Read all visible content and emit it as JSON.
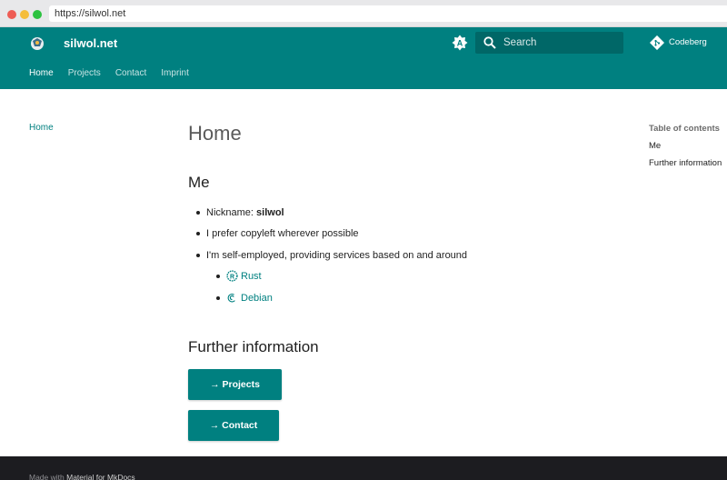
{
  "browser": {
    "url": "https://silwol.net"
  },
  "header": {
    "site_title": "silwol.net",
    "search_placeholder": "Search",
    "repo_label": "Codeberg",
    "tabs": [
      {
        "label": "Home",
        "active": true
      },
      {
        "label": "Projects",
        "active": false
      },
      {
        "label": "Contact",
        "active": false
      },
      {
        "label": "Imprint",
        "active": false
      }
    ]
  },
  "leftnav": {
    "items": [
      {
        "label": "Home"
      }
    ]
  },
  "content": {
    "title": "Home",
    "section_me": "Me",
    "nickname_label": "Nickname:",
    "nickname_value": "silwol",
    "item_copyleft": "I prefer copyleft wherever possible",
    "item_services": "I'm self-employed, providing services based on and around",
    "services": [
      {
        "label": "Rust",
        "icon": "rust-icon"
      },
      {
        "label": "Debian",
        "icon": "debian-icon"
      }
    ],
    "section_further": "Further information",
    "buttons": {
      "projects": "→ Projects",
      "contact": "→ Contact"
    }
  },
  "toc": {
    "title": "Table of contents",
    "items": [
      {
        "label": "Me"
      },
      {
        "label": "Further information"
      }
    ]
  },
  "footer": {
    "prefix": "Made with ",
    "link": "Material for MkDocs"
  },
  "colors": {
    "primary": "#008080",
    "header_search": "#006767",
    "footer_bg": "#1c1c20"
  }
}
